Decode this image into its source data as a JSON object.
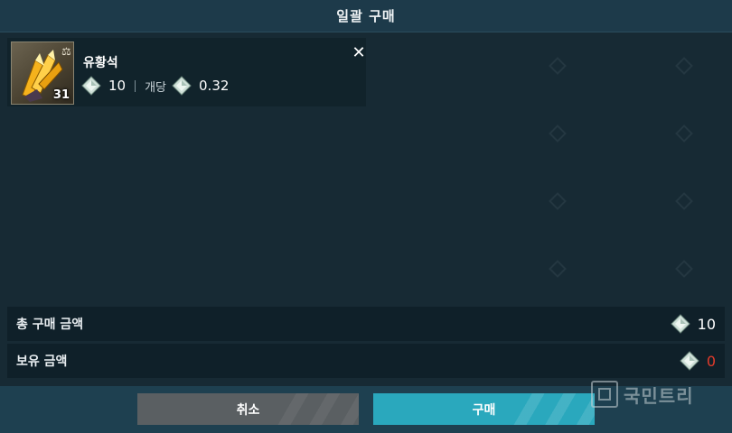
{
  "window": {
    "title": "일괄 구매"
  },
  "item": {
    "name": "유황석",
    "quantity": "31",
    "price": "10",
    "per_unit_label": "개당",
    "unit_price": "0.32",
    "icon": "sulfur-crystal-icon",
    "currency_icon": "crystal-gem-icon"
  },
  "summary": {
    "total_label": "총 구매 금액",
    "total_value": "10",
    "owned_label": "보유 금액",
    "owned_value": "0",
    "owned_color": "#e23b2b"
  },
  "buttons": {
    "cancel_label": "취소",
    "buy_label": "구매",
    "cancel_color": "#5a5f62",
    "buy_color": "#2aa8bd"
  },
  "watermark": {
    "text": "국민트리"
  }
}
